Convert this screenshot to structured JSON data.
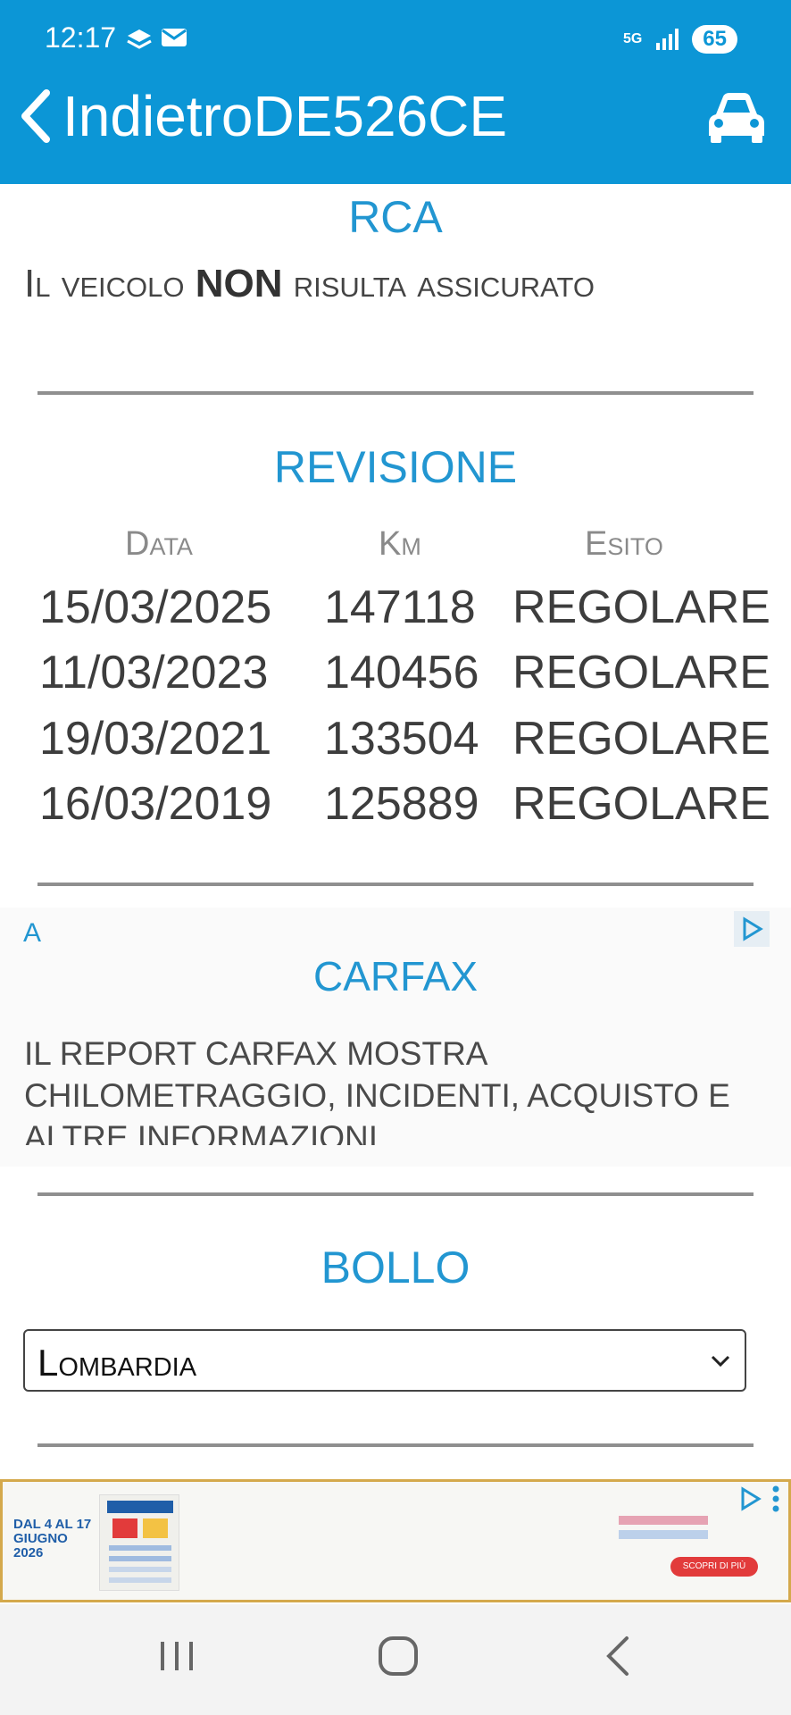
{
  "status_bar": {
    "time": "12:17",
    "battery": "65",
    "network": "5G"
  },
  "header": {
    "back_label": "Indietro",
    "plate": "DE526CE",
    "car_icon": "car-icon"
  },
  "rca": {
    "title": "RCA",
    "text_before": "Il veicolo ",
    "text_strong": "NON",
    "text_after": " risulta assicurato"
  },
  "revisione": {
    "title": "REVISIONE",
    "columns": [
      "Data",
      "Km",
      "Esito"
    ],
    "rows": [
      {
        "date": "15/03/2025",
        "km": "147118",
        "esito": "REGOLARE"
      },
      {
        "date": "11/03/2023",
        "km": "140456",
        "esito": "REGOLARE"
      },
      {
        "date": "19/03/2021",
        "km": "133504",
        "esito": "REGOLARE"
      },
      {
        "date": "16/03/2019",
        "km": "125889",
        "esito": "REGOLARE"
      }
    ]
  },
  "carfax": {
    "ad_label": "A",
    "title": "CARFAX",
    "text": "IL REPORT CARFAX MOSTRA CHILOMETRAGGIO, INCIDENTI, ACQUISTO E ALTRE INFORMAZIONI"
  },
  "bollo": {
    "title": "BOLLO",
    "selected_region": "Lombardia"
  },
  "bottom_ad": {
    "date_text": "DAL 4 AL 17 GIUGNO 2026",
    "cta": "SCOPRI DI PIÙ"
  },
  "colors": {
    "accent": "#0c96d6",
    "heading": "#2296d1",
    "divider": "#8f8f8f"
  }
}
